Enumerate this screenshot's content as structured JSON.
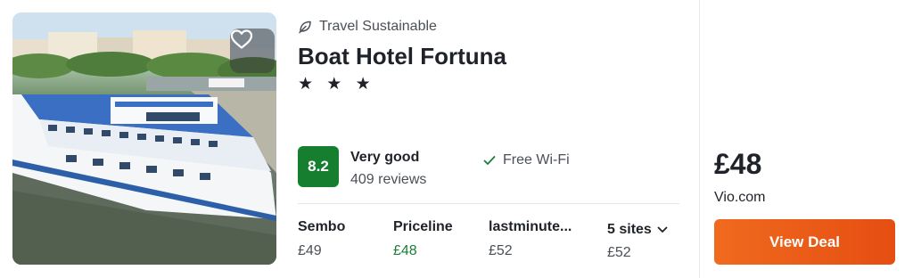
{
  "hotel": {
    "sustainable_label": "Travel Sustainable",
    "name": "Boat Hotel Fortuna",
    "stars": "★ ★ ★",
    "star_count": 3,
    "favorite_icon": "heart-outline-icon"
  },
  "rating": {
    "score": "8.2",
    "score_color": "#157f2f",
    "label": "Very good",
    "reviews": "409 reviews"
  },
  "amenity": {
    "check_icon": "check-icon",
    "label": "Free Wi-Fi"
  },
  "sites": [
    {
      "name": "Sembo",
      "price": "£49"
    },
    {
      "name": "Priceline",
      "price": "£48",
      "best": true
    },
    {
      "name": "lastminute...",
      "price": "£52"
    }
  ],
  "more_sites": {
    "label": "5 sites",
    "price": "£52",
    "icon": "chevron-down-icon"
  },
  "deal": {
    "price": "£48",
    "provider": "Vio.com",
    "button_label": "View Deal",
    "button_color": "#ea5a15"
  }
}
